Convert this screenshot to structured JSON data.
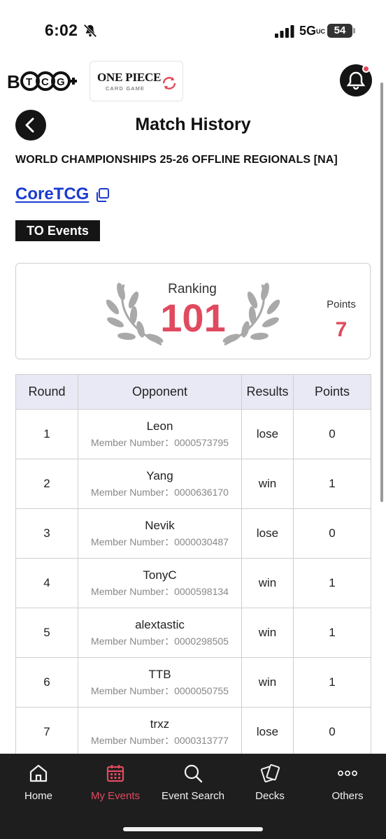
{
  "status_bar": {
    "time": "6:02",
    "network": "5G",
    "network_suffix": "UC",
    "battery": "54"
  },
  "header": {
    "app_logo": "BTCG+",
    "game_logo_title": "ONE PIECE",
    "game_logo_subtitle": "CARD GAME",
    "notification_dot_color": "#e24a5a"
  },
  "page": {
    "title": "Match History",
    "event_name": "WORLD CHAMPIONSHIPS 25-26 OFFLINE REGIONALS [NA]",
    "store_name": "CoreTCG",
    "badge": "TO Events"
  },
  "ranking": {
    "label": "Ranking",
    "value": "101",
    "points_label": "Points",
    "points": "7",
    "accent_color": "#e04a5f"
  },
  "table": {
    "headers": {
      "round": "Round",
      "opponent": "Opponent",
      "results": "Results",
      "points": "Points"
    },
    "member_prefix": "Member Number：",
    "rows": [
      {
        "round": "1",
        "name": "Leon",
        "member": "Member Number：0000573795",
        "result": "lose",
        "points": "0"
      },
      {
        "round": "2",
        "name": "Yang",
        "member": "Member Number：0000636170",
        "result": "win",
        "points": "1"
      },
      {
        "round": "3",
        "name": "Nevik",
        "member": "Member Number：0000030487",
        "result": "lose",
        "points": "0"
      },
      {
        "round": "4",
        "name": "TonyC",
        "member": "Member Number：0000598134",
        "result": "win",
        "points": "1"
      },
      {
        "round": "5",
        "name": "alextastic",
        "member": "Member Number：0000298505",
        "result": "win",
        "points": "1"
      },
      {
        "round": "6",
        "name": "TTB",
        "member": "Member Number：0000050755",
        "result": "win",
        "points": "1"
      },
      {
        "round": "7",
        "name": "trxz",
        "member": "Member Number：0000313777",
        "result": "lose",
        "points": "0"
      }
    ]
  },
  "bottom_nav": {
    "items": [
      {
        "label": "Home",
        "icon": "home-icon"
      },
      {
        "label": "My Events",
        "icon": "calendar-icon",
        "active": true
      },
      {
        "label": "Event Search",
        "icon": "search-icon"
      },
      {
        "label": "Decks",
        "icon": "cards-icon"
      },
      {
        "label": "Others",
        "icon": "more-icon"
      }
    ]
  }
}
